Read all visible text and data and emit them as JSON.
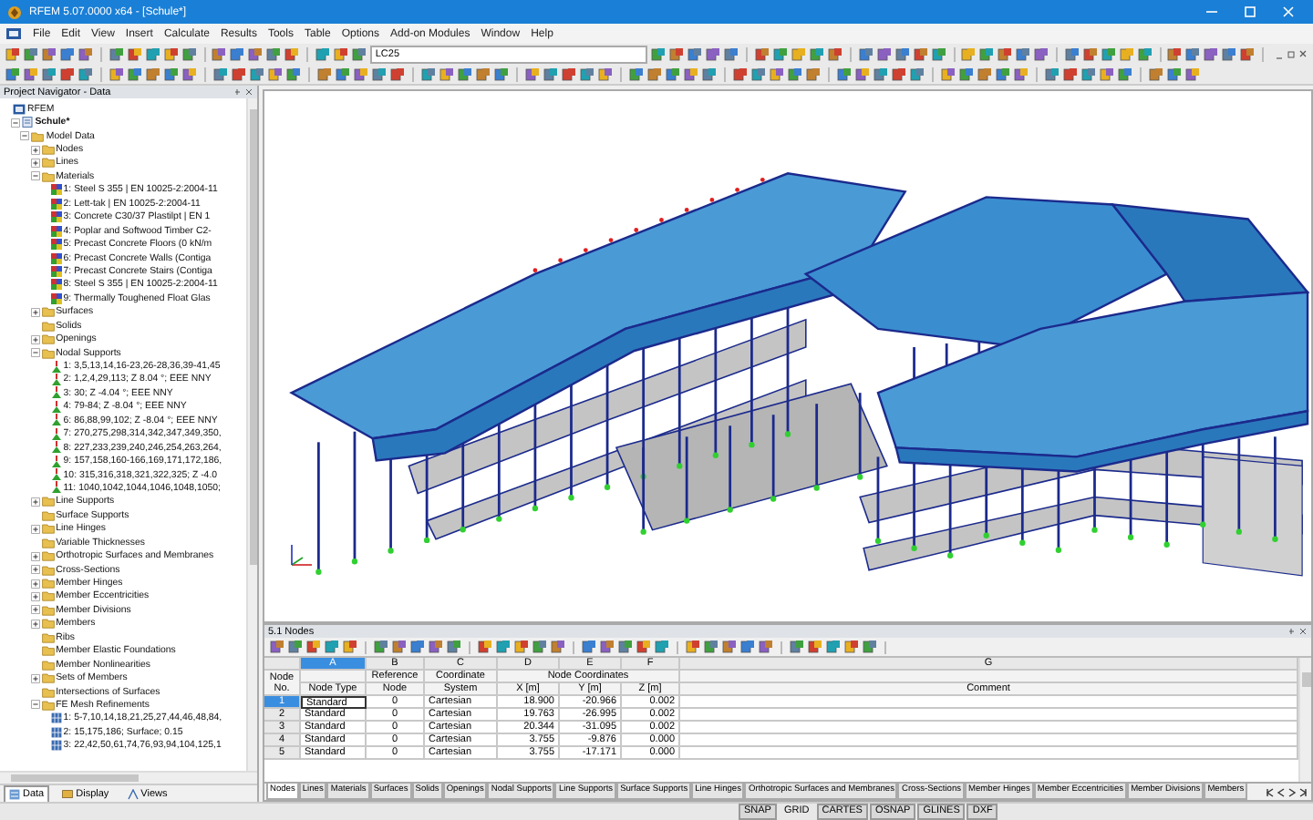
{
  "window": {
    "title": "RFEM 5.07.0000 x64 - [Schule*]"
  },
  "menu": [
    "File",
    "Edit",
    "View",
    "Insert",
    "Calculate",
    "Results",
    "Tools",
    "Table",
    "Options",
    "Add-on Modules",
    "Window",
    "Help"
  ],
  "toolbar": {
    "load_case": "LC25"
  },
  "navigator": {
    "title": "Project Navigator - Data",
    "tree": [
      {
        "label": "RFEM",
        "kind": "root",
        "children": [
          {
            "label": "Schule*",
            "kind": "model",
            "expanded": true,
            "children": [
              {
                "label": "Model Data",
                "kind": "folder",
                "expanded": true,
                "children": [
                  {
                    "label": "Nodes",
                    "kind": "folder",
                    "expanded": false
                  },
                  {
                    "label": "Lines",
                    "kind": "folder",
                    "expanded": false
                  },
                  {
                    "label": "Materials",
                    "kind": "folder",
                    "expanded": true,
                    "children": [
                      {
                        "label": "1: Steel S 355 | EN 10025-2:2004-11",
                        "kind": "material"
                      },
                      {
                        "label": "2: Lett-tak | EN 10025-2:2004-11",
                        "kind": "material"
                      },
                      {
                        "label": "3: Concrete C30/37 Plastilpt | EN 1",
                        "kind": "material"
                      },
                      {
                        "label": "4: Poplar and Softwood Timber C2-",
                        "kind": "material"
                      },
                      {
                        "label": "5: Precast Concrete Floors (0 kN/m",
                        "kind": "material"
                      },
                      {
                        "label": "6: Precast Concrete Walls (Contiga",
                        "kind": "material"
                      },
                      {
                        "label": "7: Precast Concrete Stairs (Contiga",
                        "kind": "material"
                      },
                      {
                        "label": "8: Steel S 355 | EN 10025-2:2004-11",
                        "kind": "material"
                      },
                      {
                        "label": "9: Thermally Toughened Float Glas",
                        "kind": "material"
                      }
                    ]
                  },
                  {
                    "label": "Surfaces",
                    "kind": "folder",
                    "expanded": false
                  },
                  {
                    "label": "Solids",
                    "kind": "folder"
                  },
                  {
                    "label": "Openings",
                    "kind": "folder",
                    "expanded": false
                  },
                  {
                    "label": "Nodal Supports",
                    "kind": "folder",
                    "expanded": true,
                    "children": [
                      {
                        "label": "1: 3,5,13,14,16-23,26-28,36,39-41,45",
                        "kind": "support"
                      },
                      {
                        "label": "2: 1,2,4,29,113; Z 8.04 °; EEE NNY",
                        "kind": "support"
                      },
                      {
                        "label": "3: 30; Z -4.04 °; EEE NNY",
                        "kind": "support"
                      },
                      {
                        "label": "4: 79-84; Z -8.04 °; EEE NNY",
                        "kind": "support"
                      },
                      {
                        "label": "6: 86,88,99,102; Z -8.04 °; EEE NNY",
                        "kind": "support"
                      },
                      {
                        "label": "7: 270,275,298,314,342,347,349,350,",
                        "kind": "support"
                      },
                      {
                        "label": "8: 227,233,239,240,246,254,263,264,",
                        "kind": "support"
                      },
                      {
                        "label": "9: 157,158,160-166,169,171,172,186,",
                        "kind": "support"
                      },
                      {
                        "label": "10: 315,316,318,321,322,325; Z -4.0",
                        "kind": "support"
                      },
                      {
                        "label": "11: 1040,1042,1044,1046,1048,1050;",
                        "kind": "support"
                      }
                    ]
                  },
                  {
                    "label": "Line Supports",
                    "kind": "folder",
                    "expanded": false
                  },
                  {
                    "label": "Surface Supports",
                    "kind": "folder"
                  },
                  {
                    "label": "Line Hinges",
                    "kind": "folder",
                    "expanded": false
                  },
                  {
                    "label": "Variable Thicknesses",
                    "kind": "folder"
                  },
                  {
                    "label": "Orthotropic Surfaces and Membranes",
                    "kind": "folder",
                    "expanded": false
                  },
                  {
                    "label": "Cross-Sections",
                    "kind": "folder",
                    "expanded": false
                  },
                  {
                    "label": "Member Hinges",
                    "kind": "folder",
                    "expanded": false
                  },
                  {
                    "label": "Member Eccentricities",
                    "kind": "folder",
                    "expanded": false
                  },
                  {
                    "label": "Member Divisions",
                    "kind": "folder",
                    "expanded": false
                  },
                  {
                    "label": "Members",
                    "kind": "folder",
                    "expanded": false
                  },
                  {
                    "label": "Ribs",
                    "kind": "folder"
                  },
                  {
                    "label": "Member Elastic Foundations",
                    "kind": "folder"
                  },
                  {
                    "label": "Member Nonlinearities",
                    "kind": "folder"
                  },
                  {
                    "label": "Sets of Members",
                    "kind": "folder",
                    "expanded": false
                  },
                  {
                    "label": "Intersections of Surfaces",
                    "kind": "folder"
                  },
                  {
                    "label": "FE Mesh Refinements",
                    "kind": "folder",
                    "expanded": true,
                    "children": [
                      {
                        "label": "1: 5-7,10,14,18,21,25,27,44,46,48,84,",
                        "kind": "mesh"
                      },
                      {
                        "label": "2: 15,175,186; Surface; 0.15",
                        "kind": "mesh"
                      },
                      {
                        "label": "3: 22,42,50,61,74,76,93,94,104,125,1",
                        "kind": "mesh"
                      }
                    ]
                  }
                ]
              }
            ]
          }
        ]
      }
    ],
    "tabs": [
      {
        "label": "Data",
        "selected": true
      },
      {
        "label": "Display",
        "selected": false
      },
      {
        "label": "Views",
        "selected": false
      }
    ]
  },
  "table": {
    "title": "5.1 Nodes",
    "row_heading": "Node No.",
    "columns": [
      {
        "letter": "A",
        "heading": "Node Type"
      },
      {
        "letter": "B",
        "heading_top": "Reference",
        "heading": "Node"
      },
      {
        "letter": "C",
        "heading_top": "Coordinate",
        "heading": "System"
      },
      {
        "letter": "D",
        "group_heading": "Node Coordinates",
        "heading": "X [m]"
      },
      {
        "letter": "E",
        "grouped": true,
        "heading": "Y [m]"
      },
      {
        "letter": "F",
        "grouped": true,
        "heading": "Z [m]"
      },
      {
        "letter": "G",
        "heading": "Comment"
      }
    ],
    "rows": [
      {
        "no": "1",
        "selected": true,
        "cells": [
          "Standard",
          "0",
          "Cartesian",
          "18.900",
          "-20.966",
          "0.002"
        ]
      },
      {
        "no": "2",
        "selected": false,
        "cells": [
          "Standard",
          "0",
          "Cartesian",
          "19.763",
          "-26.995",
          "0.002"
        ]
      },
      {
        "no": "3",
        "selected": false,
        "cells": [
          "Standard",
          "0",
          "Cartesian",
          "20.344",
          "-31.095",
          "0.002"
        ]
      },
      {
        "no": "4",
        "selected": false,
        "cells": [
          "Standard",
          "0",
          "Cartesian",
          "3.755",
          "-9.876",
          "0.000"
        ]
      },
      {
        "no": "5",
        "selected": false,
        "cells": [
          "Standard",
          "0",
          "Cartesian",
          "3.755",
          "-17.171",
          "0.000"
        ]
      }
    ],
    "tabs": [
      {
        "label": "Nodes",
        "selected": true
      },
      {
        "label": "Lines",
        "selected": false
      },
      {
        "label": "Materials",
        "selected": false
      },
      {
        "label": "Surfaces",
        "selected": false
      },
      {
        "label": "Solids",
        "selected": false
      },
      {
        "label": "Openings",
        "selected": false
      },
      {
        "label": "Nodal Supports",
        "selected": false
      },
      {
        "label": "Line Supports",
        "selected": false
      },
      {
        "label": "Surface Supports",
        "selected": false
      },
      {
        "label": "Line Hinges",
        "selected": false
      },
      {
        "label": "Orthotropic Surfaces and Membranes",
        "selected": false
      },
      {
        "label": "Cross-Sections",
        "selected": false
      },
      {
        "label": "Member Hinges",
        "selected": false
      },
      {
        "label": "Member Eccentricities",
        "selected": false
      },
      {
        "label": "Member Divisions",
        "selected": false
      },
      {
        "label": "Members",
        "selected": false
      }
    ]
  },
  "status_bar": {
    "toggles": [
      {
        "label": "SNAP",
        "on": true
      },
      {
        "label": "GRID",
        "on": false
      },
      {
        "label": "CARTES",
        "on": true
      },
      {
        "label": "OSNAP",
        "on": true
      },
      {
        "label": "GLINES",
        "on": true
      },
      {
        "label": "DXF",
        "on": true
      }
    ]
  }
}
